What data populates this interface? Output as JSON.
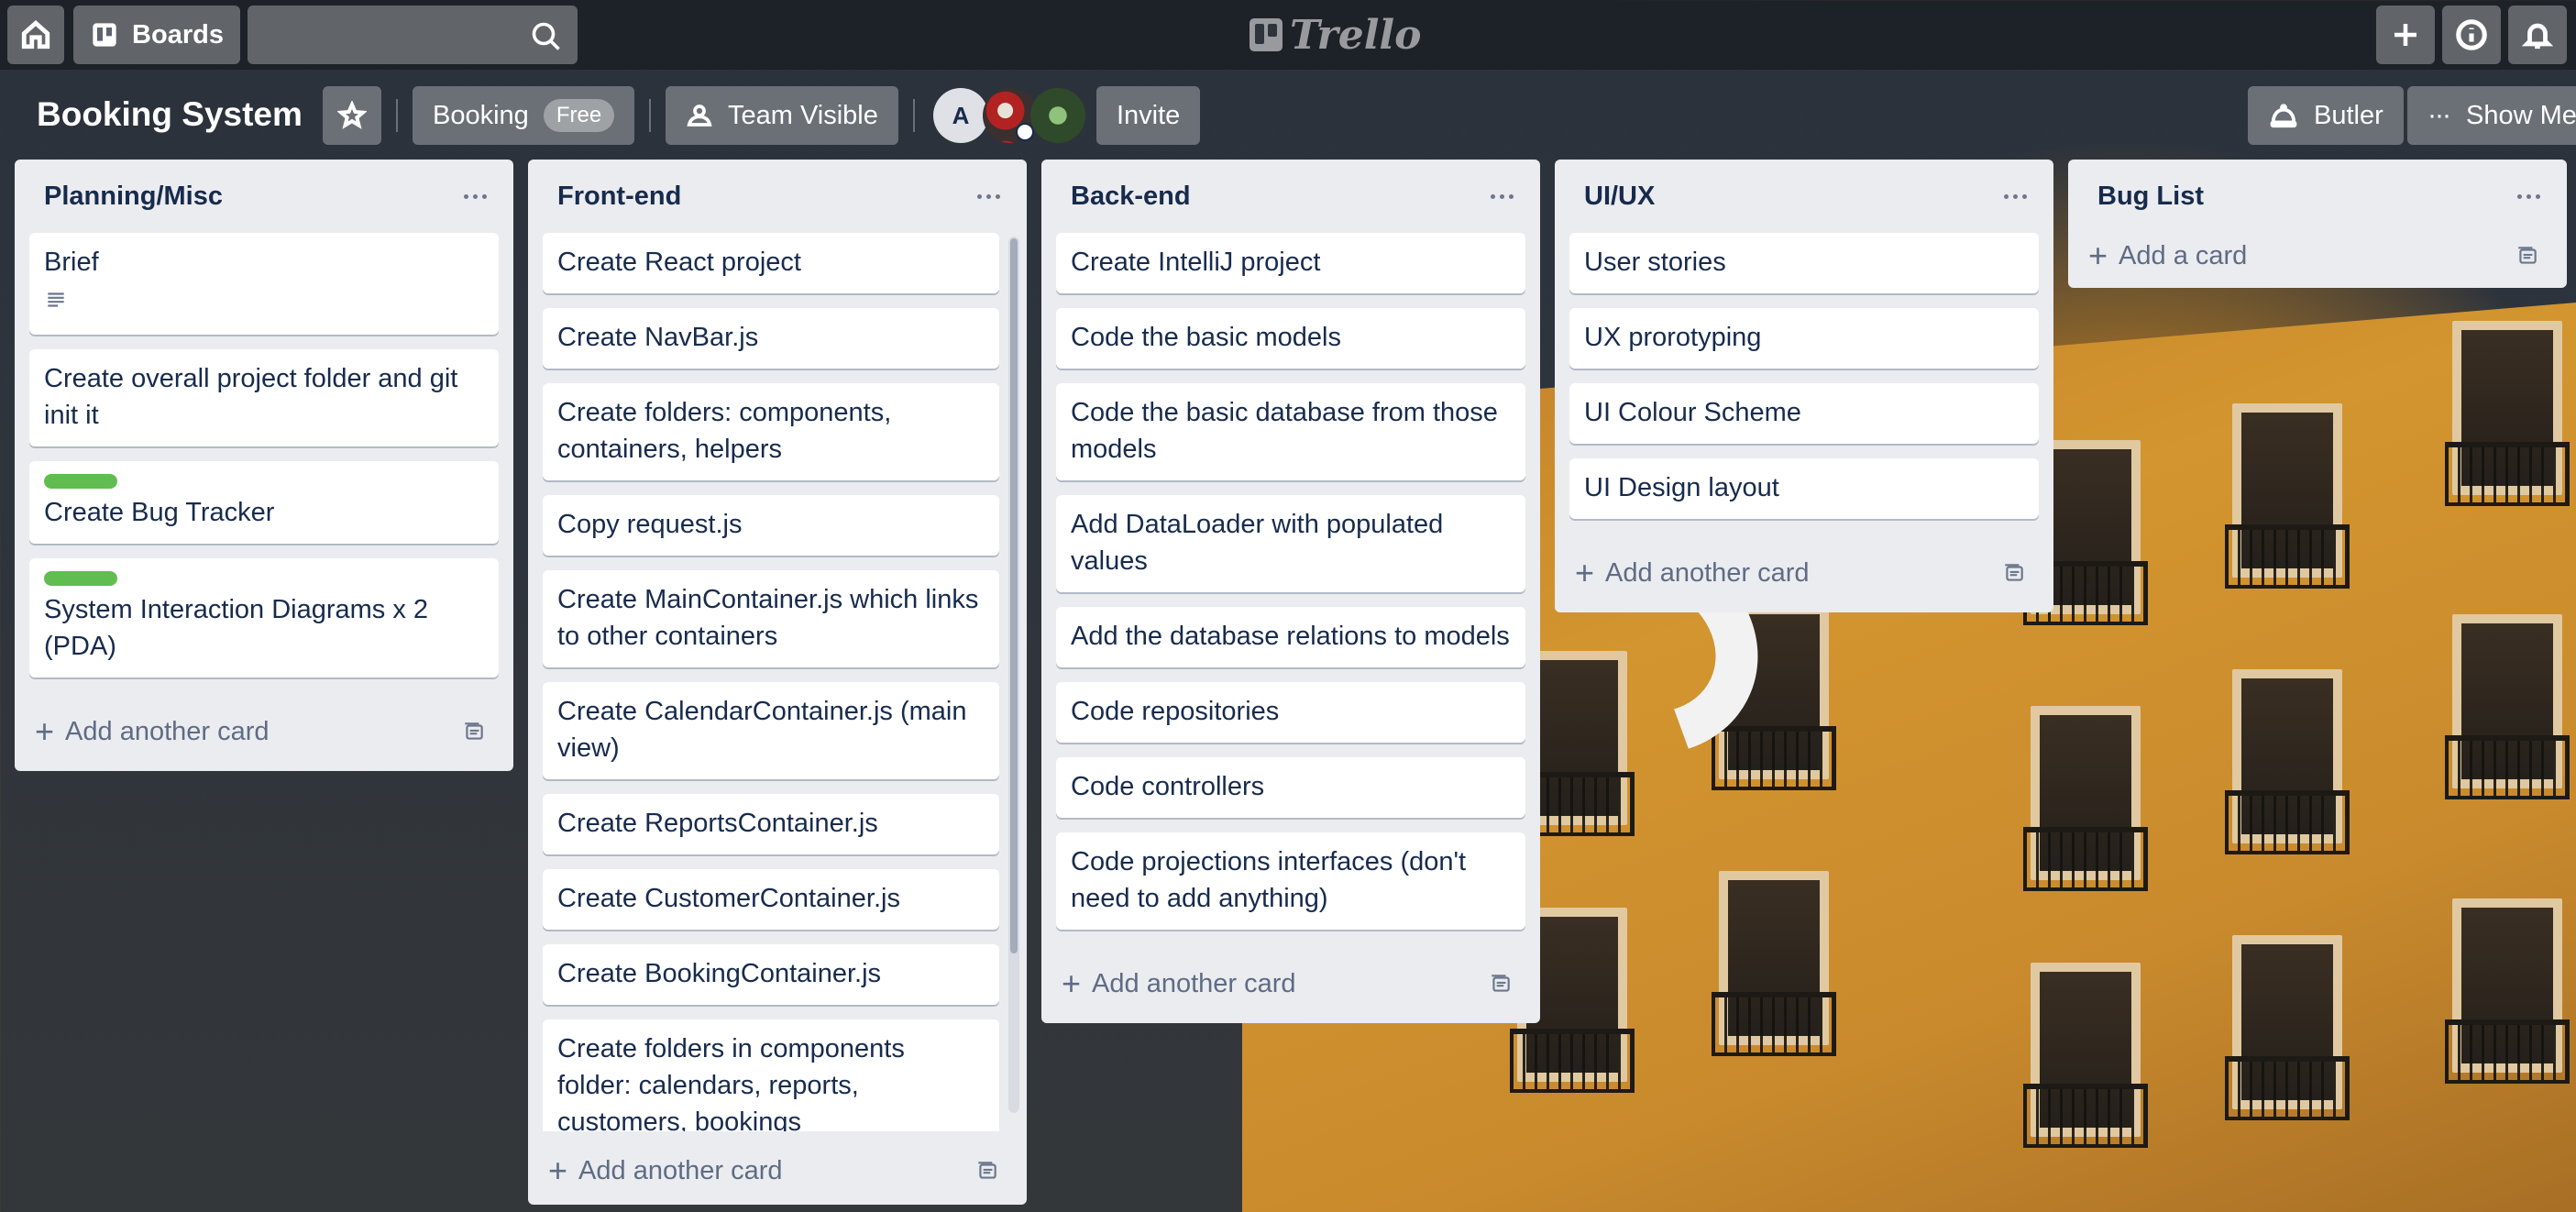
{
  "header": {
    "boards_label": "Boards",
    "search_value": "",
    "logo_text": "Trello"
  },
  "board": {
    "title": "Booking System",
    "team_name": "Booking",
    "team_plan": "Free",
    "visibility_label": "Team Visible",
    "member_initial": "A",
    "invite_label": "Invite",
    "butler_label": "Butler",
    "show_menu_label": "Show Me"
  },
  "lists": [
    {
      "title": "Planning/Misc",
      "cards": [
        {
          "text": "Brief",
          "label": null,
          "has_description": true
        },
        {
          "text": "Create overall project folder and git init it",
          "label": null
        },
        {
          "text": "Create Bug Tracker",
          "label": "green"
        },
        {
          "text": "System Interaction Diagrams x 2 (PDA)",
          "label": "green"
        }
      ],
      "footer": "Add another card"
    },
    {
      "title": "Front-end",
      "cards": [
        {
          "text": "Create React project"
        },
        {
          "text": "Create NavBar.js"
        },
        {
          "text": "Create folders: components, containers, helpers"
        },
        {
          "text": "Copy request.js"
        },
        {
          "text": "Create MainContainer.js which links to other containers"
        },
        {
          "text": "Create CalendarContainer.js (main view)"
        },
        {
          "text": "Create ReportsContainer.js"
        },
        {
          "text": "Create CustomerContainer.js"
        },
        {
          "text": "Create BookingContainer.js"
        },
        {
          "text": "Create folders in components folder: calendars, reports, customers, bookings"
        }
      ],
      "footer": "Add another card"
    },
    {
      "title": "Back-end",
      "cards": [
        {
          "text": "Create IntelliJ project"
        },
        {
          "text": "Code the basic models"
        },
        {
          "text": "Code the basic database from those models"
        },
        {
          "text": "Add DataLoader with populated values"
        },
        {
          "text": "Add the database relations to models"
        },
        {
          "text": "Code repositories"
        },
        {
          "text": "Code controllers"
        },
        {
          "text": "Code projections interfaces (don't need to add anything)"
        }
      ],
      "footer": "Add another card"
    },
    {
      "title": "UI/UX",
      "cards": [
        {
          "text": "User stories"
        },
        {
          "text": "UX prorotyping"
        },
        {
          "text": "UI Colour Scheme"
        },
        {
          "text": "UI Design layout"
        }
      ],
      "footer": "Add another card"
    },
    {
      "title": "Bug List",
      "cards": [],
      "footer": "Add a card"
    }
  ],
  "colors": {
    "list_bg": "#ebecf0",
    "label_green": "#61bd4f",
    "text_dark": "#172b4d",
    "text_muted": "#5e6c84"
  },
  "icons": [
    "home-icon",
    "boards-icon",
    "search-icon",
    "plus-icon",
    "info-icon",
    "bell-icon",
    "star-icon",
    "team-icon",
    "butler-icon",
    "more-icon",
    "description-icon",
    "template-icon"
  ]
}
